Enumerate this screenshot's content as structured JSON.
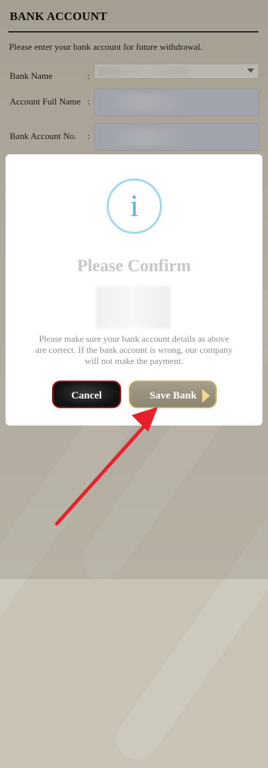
{
  "page": {
    "title": "BANK ACCOUNT",
    "intro": "Please enter your bank account for future withdrawal."
  },
  "form": {
    "bank_name_label": "Bank Name",
    "full_name_label": "Account Full Name",
    "account_no_label": "Bank Account No.",
    "colon": ":"
  },
  "modal": {
    "icon_glyph": "i",
    "title": "Please Confirm",
    "message": "Please make sure your bank account details as above are correct. If the bank account is wrong, our company will not make the payment.",
    "cancel_label": "Cancel",
    "save_label": "Save Bank"
  },
  "colors": {
    "cancel_border": "#b0111a",
    "save_border": "#c8b06a",
    "info_icon": "#4fb6dc",
    "annotation_arrow": "#e8202a"
  }
}
